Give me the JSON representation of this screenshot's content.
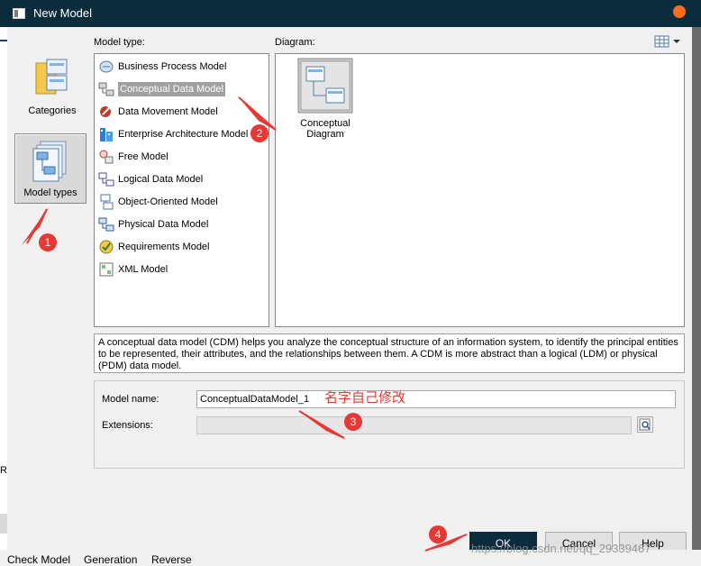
{
  "window": {
    "title": "New Model"
  },
  "categories": [
    {
      "label": "Categories",
      "selected": false,
      "icon": "folder-categories-icon"
    },
    {
      "label": "Model types",
      "selected": true,
      "icon": "model-types-icon"
    }
  ],
  "model_type": {
    "label": "Model type:",
    "items": [
      {
        "label": "Business Process Model",
        "icon": "business-process-icon",
        "selected": false
      },
      {
        "label": "Conceptual Data Model",
        "icon": "conceptual-data-icon",
        "selected": true
      },
      {
        "label": "Data Movement Model",
        "icon": "data-movement-icon",
        "selected": false
      },
      {
        "label": "Enterprise Architecture Model",
        "icon": "enterprise-architecture-icon",
        "selected": false
      },
      {
        "label": "Free Model",
        "icon": "free-model-icon",
        "selected": false
      },
      {
        "label": "Logical Data Model",
        "icon": "logical-data-icon",
        "selected": false
      },
      {
        "label": "Object-Oriented Model",
        "icon": "object-oriented-icon",
        "selected": false
      },
      {
        "label": "Physical Data Model",
        "icon": "physical-data-icon",
        "selected": false
      },
      {
        "label": "Requirements Model",
        "icon": "requirements-icon",
        "selected": false
      },
      {
        "label": "XML Model",
        "icon": "xml-model-icon",
        "selected": false
      }
    ]
  },
  "diagram": {
    "label": "Diagram:",
    "items": [
      {
        "label": "Conceptual Diagram",
        "icon": "conceptual-diagram-icon"
      }
    ]
  },
  "description": "A conceptual data model (CDM) helps you analyze the conceptual structure of an information system, to identify the principal entities to be represented, their attributes, and the relationships between them. A CDM is more abstract than a logical (LDM) or physical (PDM) data model.",
  "form": {
    "model_name_label": "Model name:",
    "model_name_value": "ConceptualDataModel_1",
    "extensions_label": "Extensions:",
    "extensions_value": ""
  },
  "buttons": {
    "ok": "OK",
    "cancel": "Cancel",
    "help": "Help"
  },
  "annotations": {
    "badges": [
      "1",
      "2",
      "3",
      "4"
    ],
    "note": "名字自己修改",
    "color": "#e53935"
  },
  "background": {
    "left_text": "Re",
    "bottom_tabs": [
      "Check Model",
      "Generation",
      "Reverse"
    ]
  },
  "watermark": "https://blog.csdn.net/qq_29339467",
  "colors": {
    "titlebar": "#0b2c3d",
    "close": "#ff6b1a",
    "selection": "#a0a0a0"
  }
}
